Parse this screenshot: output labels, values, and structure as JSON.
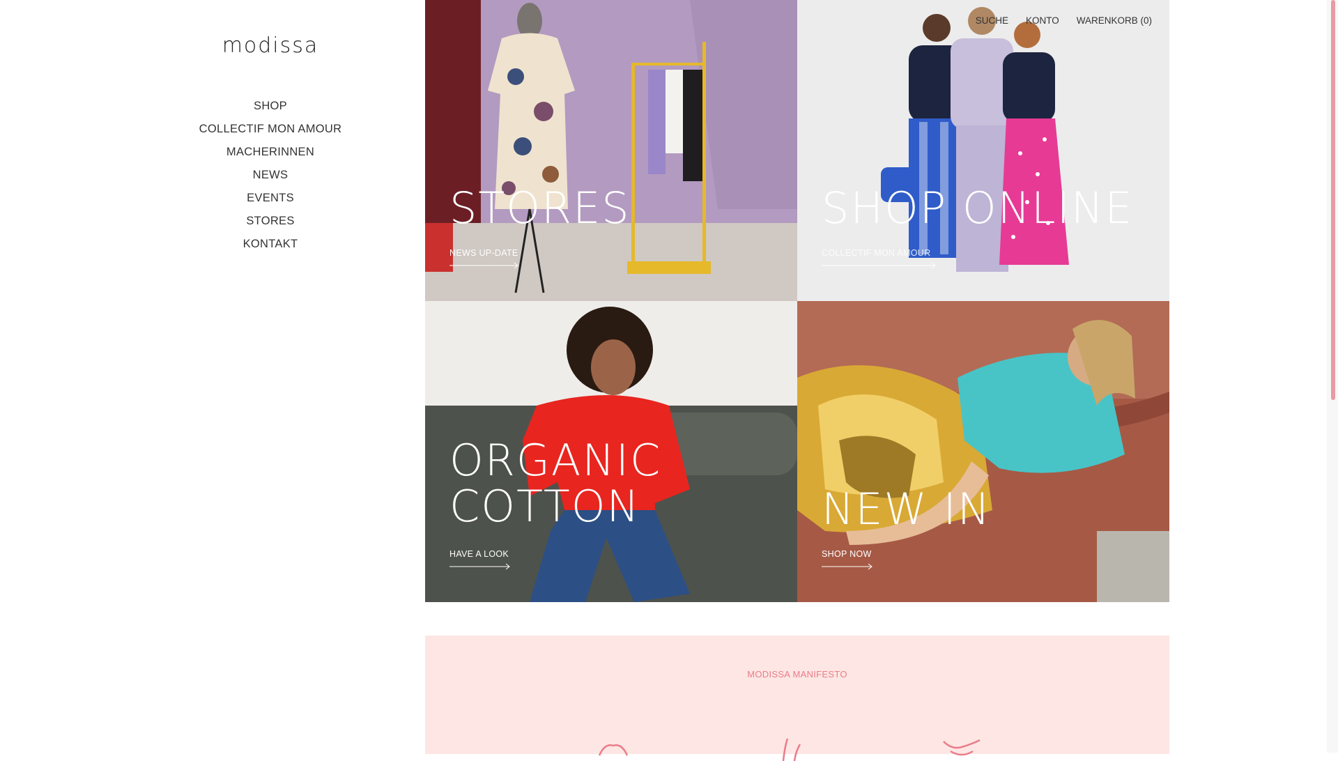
{
  "brand": {
    "logo": "modissa"
  },
  "nav": {
    "items": [
      "SHOP",
      "COLLECTIF MON AMOUR",
      "MACHERINNEN",
      "NEWS",
      "EVENTS",
      "STORES",
      "KONTAKT"
    ]
  },
  "top_menu": {
    "search": "SUCHE",
    "account": "KONTO",
    "cart": "WARENKORB (0)"
  },
  "tiles": [
    {
      "title": "STORES",
      "cta": "NEWS UP-DATE",
      "image": "store-interior-dress-mannequin-rack"
    },
    {
      "title": "SHOP ONLINE",
      "cta": "COLLECTIF MON AMOUR",
      "image": "three-women-colorful-outfits"
    },
    {
      "title_line1": "ORGANIC",
      "title_line2": "COTTON",
      "cta": "HAVE A LOOK",
      "image": "woman-red-sweater-sofa"
    },
    {
      "title": "NEW IN",
      "cta": "SHOP NOW",
      "image": "woman-turquoise-top-gold-skirt-sofa"
    }
  ],
  "manifesto": {
    "label": "MODISSA MANIFESTO"
  },
  "colors": {
    "accent": "#ea7c8a",
    "manifesto_bg": "#fde6e3",
    "scroll_thumb": "#e89ba3"
  }
}
